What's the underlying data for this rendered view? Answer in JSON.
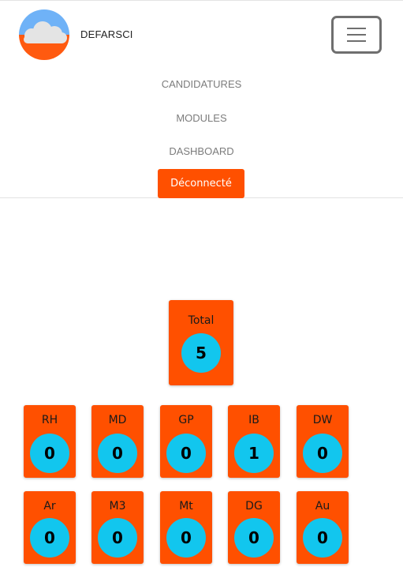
{
  "header": {
    "brand": "DEFARSCI",
    "logo_icon": "cloud-sun-logo-icon",
    "menu_icon": "hamburger-menu-icon"
  },
  "nav": {
    "items": [
      {
        "label": "CANDIDATURES"
      },
      {
        "label": "MODULES"
      },
      {
        "label": "DASHBOARD"
      }
    ],
    "logout_label": "Déconnecté"
  },
  "colors": {
    "accent": "#ff5000",
    "bubble": "#12c6ee"
  },
  "total": {
    "label": "Total",
    "value": "5"
  },
  "stats_row1": [
    {
      "label": "RH",
      "value": "0"
    },
    {
      "label": "MD",
      "value": "0"
    },
    {
      "label": "GP",
      "value": "0"
    },
    {
      "label": "IB",
      "value": "1"
    },
    {
      "label": "DW",
      "value": "0"
    }
  ],
  "stats_row2": [
    {
      "label": "Ar",
      "value": "0"
    },
    {
      "label": "M3",
      "value": "0"
    },
    {
      "label": "Mt",
      "value": "0"
    },
    {
      "label": "DG",
      "value": "0"
    },
    {
      "label": "Au",
      "value": "0"
    }
  ]
}
